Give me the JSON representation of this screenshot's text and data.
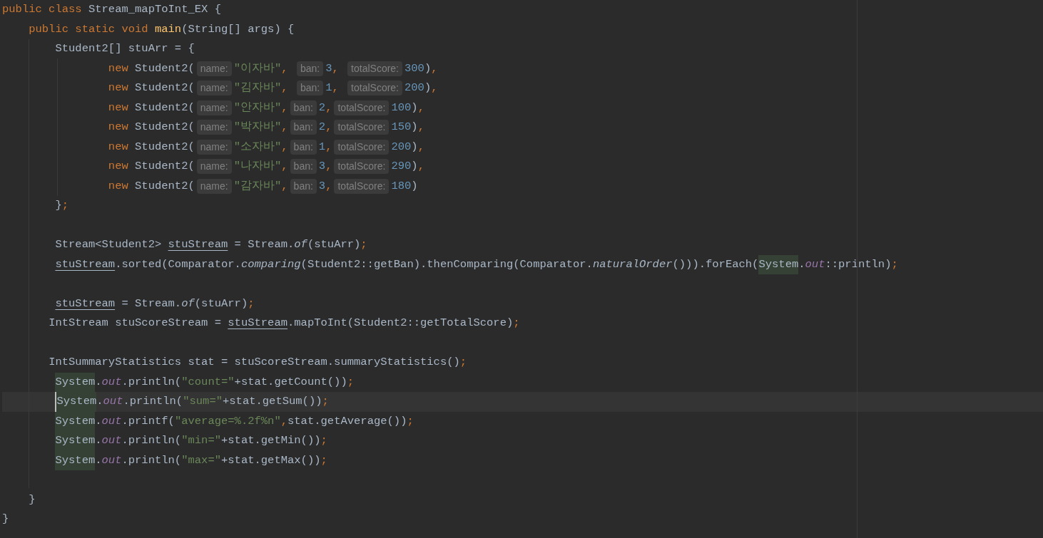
{
  "editor": {
    "lines": [
      {
        "selected": false,
        "tokens": [
          {
            "kind": "keyword",
            "text": "public class "
          },
          {
            "kind": "plain",
            "text": "Stream_mapToInt_EX {"
          }
        ]
      },
      {
        "selected": false,
        "tokens": [
          {
            "kind": "keyword",
            "text": "    public static void "
          },
          {
            "kind": "method",
            "text": "main"
          },
          {
            "kind": "plain",
            "text": "(String[] args) {"
          }
        ]
      },
      {
        "selected": false,
        "tokens": [
          {
            "kind": "plain",
            "text": "        Student2[] stuArr = {"
          }
        ]
      },
      {
        "selected": false,
        "tokens": [
          {
            "kind": "keyword",
            "text": "                new "
          },
          {
            "kind": "plain",
            "text": "Student2("
          },
          {
            "kind": "hint",
            "text": "name:"
          },
          {
            "kind": "string",
            "text": "\"이자바\""
          },
          {
            "kind": "keyword",
            "text": ", "
          },
          {
            "kind": "hint",
            "text": "ban:"
          },
          {
            "kind": "number",
            "text": "3"
          },
          {
            "kind": "keyword",
            "text": ", "
          },
          {
            "kind": "hint",
            "text": "totalScore:"
          },
          {
            "kind": "number",
            "text": "300"
          },
          {
            "kind": "plain",
            "text": ")"
          },
          {
            "kind": "keyword",
            "text": ","
          }
        ]
      },
      {
        "selected": false,
        "tokens": [
          {
            "kind": "keyword",
            "text": "                new "
          },
          {
            "kind": "plain",
            "text": "Student2("
          },
          {
            "kind": "hint",
            "text": "name:"
          },
          {
            "kind": "string",
            "text": "\"김자바\""
          },
          {
            "kind": "keyword",
            "text": ", "
          },
          {
            "kind": "hint",
            "text": "ban:"
          },
          {
            "kind": "number",
            "text": "1"
          },
          {
            "kind": "keyword",
            "text": ", "
          },
          {
            "kind": "hint",
            "text": "totalScore:"
          },
          {
            "kind": "number",
            "text": "200"
          },
          {
            "kind": "plain",
            "text": ")"
          },
          {
            "kind": "keyword",
            "text": ","
          }
        ]
      },
      {
        "selected": false,
        "tokens": [
          {
            "kind": "keyword",
            "text": "                new "
          },
          {
            "kind": "plain",
            "text": "Student2("
          },
          {
            "kind": "hint",
            "text": "name:"
          },
          {
            "kind": "string",
            "text": "\"안자바\""
          },
          {
            "kind": "keyword",
            "text": ","
          },
          {
            "kind": "hint",
            "text": "ban:"
          },
          {
            "kind": "number",
            "text": "2"
          },
          {
            "kind": "keyword",
            "text": ","
          },
          {
            "kind": "hint",
            "text": "totalScore:"
          },
          {
            "kind": "number",
            "text": "100"
          },
          {
            "kind": "plain",
            "text": ")"
          },
          {
            "kind": "keyword",
            "text": ","
          }
        ]
      },
      {
        "selected": false,
        "tokens": [
          {
            "kind": "keyword",
            "text": "                new "
          },
          {
            "kind": "plain",
            "text": "Student2("
          },
          {
            "kind": "hint",
            "text": "name:"
          },
          {
            "kind": "string",
            "text": "\"박자바\""
          },
          {
            "kind": "keyword",
            "text": ","
          },
          {
            "kind": "hint",
            "text": "ban:"
          },
          {
            "kind": "number",
            "text": "2"
          },
          {
            "kind": "keyword",
            "text": ","
          },
          {
            "kind": "hint",
            "text": "totalScore:"
          },
          {
            "kind": "number",
            "text": "150"
          },
          {
            "kind": "plain",
            "text": ")"
          },
          {
            "kind": "keyword",
            "text": ","
          }
        ]
      },
      {
        "selected": false,
        "tokens": [
          {
            "kind": "keyword",
            "text": "                new "
          },
          {
            "kind": "plain",
            "text": "Student2("
          },
          {
            "kind": "hint",
            "text": "name:"
          },
          {
            "kind": "string",
            "text": "\"소자바\""
          },
          {
            "kind": "keyword",
            "text": ","
          },
          {
            "kind": "hint",
            "text": "ban:"
          },
          {
            "kind": "number",
            "text": "1"
          },
          {
            "kind": "keyword",
            "text": ","
          },
          {
            "kind": "hint",
            "text": "totalScore:"
          },
          {
            "kind": "number",
            "text": "200"
          },
          {
            "kind": "plain",
            "text": ")"
          },
          {
            "kind": "keyword",
            "text": ","
          }
        ]
      },
      {
        "selected": false,
        "tokens": [
          {
            "kind": "keyword",
            "text": "                new "
          },
          {
            "kind": "plain",
            "text": "Student2("
          },
          {
            "kind": "hint",
            "text": "name:"
          },
          {
            "kind": "string",
            "text": "\"나자바\""
          },
          {
            "kind": "keyword",
            "text": ","
          },
          {
            "kind": "hint",
            "text": "ban:"
          },
          {
            "kind": "number",
            "text": "3"
          },
          {
            "kind": "keyword",
            "text": ","
          },
          {
            "kind": "hint",
            "text": "totalScore:"
          },
          {
            "kind": "number",
            "text": "290"
          },
          {
            "kind": "plain",
            "text": ")"
          },
          {
            "kind": "keyword",
            "text": ","
          }
        ]
      },
      {
        "selected": false,
        "tokens": [
          {
            "kind": "keyword",
            "text": "                new "
          },
          {
            "kind": "plain",
            "text": "Student2("
          },
          {
            "kind": "hint",
            "text": "name:"
          },
          {
            "kind": "string",
            "text": "\"감자바\""
          },
          {
            "kind": "keyword",
            "text": ","
          },
          {
            "kind": "hint",
            "text": "ban:"
          },
          {
            "kind": "number",
            "text": "3"
          },
          {
            "kind": "keyword",
            "text": ","
          },
          {
            "kind": "hint",
            "text": "totalScore:"
          },
          {
            "kind": "number",
            "text": "180"
          },
          {
            "kind": "plain",
            "text": ")"
          }
        ]
      },
      {
        "selected": false,
        "tokens": [
          {
            "kind": "plain",
            "text": "        }"
          },
          {
            "kind": "keyword",
            "text": ";"
          }
        ]
      },
      {
        "blank_line_before": true,
        "selected": false,
        "tokens": [
          {
            "kind": "plain",
            "text": "        Stream<Student2> "
          },
          {
            "kind": "underline",
            "text": "stuStream"
          },
          {
            "kind": "plain",
            "text": " = Stream."
          },
          {
            "kind": "static-call",
            "text": "of"
          },
          {
            "kind": "plain",
            "text": "(stuArr)"
          },
          {
            "kind": "keyword",
            "text": ";"
          }
        ]
      },
      {
        "selected": false,
        "tokens": [
          {
            "kind": "underline",
            "text": "        stuStream"
          },
          {
            "kind": "plain",
            "text": ".sorted(Comparator."
          },
          {
            "kind": "static-call",
            "text": "comparing"
          },
          {
            "kind": "plain",
            "text": "(Student2::getBan).thenComparing(Comparator."
          },
          {
            "kind": "static-call",
            "text": "naturalOrder"
          },
          {
            "kind": "plain",
            "text": "())).forEach("
          },
          {
            "kind": "usage",
            "text": "System"
          },
          {
            "kind": "plain",
            "text": "."
          },
          {
            "kind": "static-field",
            "text": "out"
          },
          {
            "kind": "plain",
            "text": "::println)"
          },
          {
            "kind": "keyword",
            "text": ";"
          }
        ]
      },
      {
        "blank_line_before": true,
        "selected": false,
        "tokens": [
          {
            "kind": "underline",
            "text": "        stuStream"
          },
          {
            "kind": "plain",
            "text": " = Stream."
          },
          {
            "kind": "static-call",
            "text": "of"
          },
          {
            "kind": "plain",
            "text": "(stuArr)"
          },
          {
            "kind": "keyword",
            "text": ";"
          }
        ]
      },
      {
        "selected": false,
        "tokens": [
          {
            "kind": "plain",
            "text": "       IntStream stuScoreStream = "
          },
          {
            "kind": "underline",
            "text": "stuStream"
          },
          {
            "kind": "plain",
            "text": ".mapToInt(Student2::getTotalScore)"
          },
          {
            "kind": "keyword",
            "text": ";"
          }
        ]
      },
      {
        "blank_line_before": true,
        "selected": false,
        "tokens": [
          {
            "kind": "plain",
            "text": "       IntSummaryStatistics stat = stuScoreStream.summaryStatistics()"
          },
          {
            "kind": "keyword",
            "text": ";"
          }
        ]
      },
      {
        "selected": false,
        "tokens": [
          {
            "kind": "usage",
            "text": "        System"
          },
          {
            "kind": "plain",
            "text": "."
          },
          {
            "kind": "static-field",
            "text": "out"
          },
          {
            "kind": "plain",
            "text": ".println("
          },
          {
            "kind": "string",
            "text": "\"count=\""
          },
          {
            "kind": "plain",
            "text": "+stat.getCount())"
          },
          {
            "kind": "keyword",
            "text": ";"
          }
        ]
      },
      {
        "selected": true,
        "tokens": [
          {
            "kind": "usage",
            "text": "        System"
          },
          {
            "kind": "plain",
            "text": "."
          },
          {
            "kind": "static-field",
            "text": "out"
          },
          {
            "kind": "plain",
            "text": ".println("
          },
          {
            "kind": "string",
            "text": "\"sum=\""
          },
          {
            "kind": "plain",
            "text": "+stat.getSum())"
          },
          {
            "kind": "keyword",
            "text": ";"
          }
        ]
      },
      {
        "selected": false,
        "tokens": [
          {
            "kind": "usage",
            "text": "        System"
          },
          {
            "kind": "plain",
            "text": "."
          },
          {
            "kind": "static-field",
            "text": "out"
          },
          {
            "kind": "plain",
            "text": ".printf("
          },
          {
            "kind": "string",
            "text": "\"average=%.2f%n\""
          },
          {
            "kind": "keyword",
            "text": ","
          },
          {
            "kind": "plain",
            "text": "stat.getAverage())"
          },
          {
            "kind": "keyword",
            "text": ";"
          }
        ]
      },
      {
        "selected": false,
        "tokens": [
          {
            "kind": "usage",
            "text": "        System"
          },
          {
            "kind": "plain",
            "text": "."
          },
          {
            "kind": "static-field",
            "text": "out"
          },
          {
            "kind": "plain",
            "text": ".println("
          },
          {
            "kind": "string",
            "text": "\"min=\""
          },
          {
            "kind": "plain",
            "text": "+stat.getMin())"
          },
          {
            "kind": "keyword",
            "text": ";"
          }
        ]
      },
      {
        "selected": false,
        "tokens": [
          {
            "kind": "usage",
            "text": "        System"
          },
          {
            "kind": "plain",
            "text": "."
          },
          {
            "kind": "static-field",
            "text": "out"
          },
          {
            "kind": "plain",
            "text": ".println("
          },
          {
            "kind": "string",
            "text": "\"max=\""
          },
          {
            "kind": "plain",
            "text": "+stat.getMax())"
          },
          {
            "kind": "keyword",
            "text": ";"
          }
        ]
      },
      {
        "blank_line_before": true,
        "selected": false,
        "tokens": [
          {
            "kind": "plain",
            "text": "    }"
          }
        ]
      },
      {
        "selected": false,
        "tokens": [
          {
            "kind": "plain",
            "text": "}"
          }
        ]
      }
    ]
  }
}
